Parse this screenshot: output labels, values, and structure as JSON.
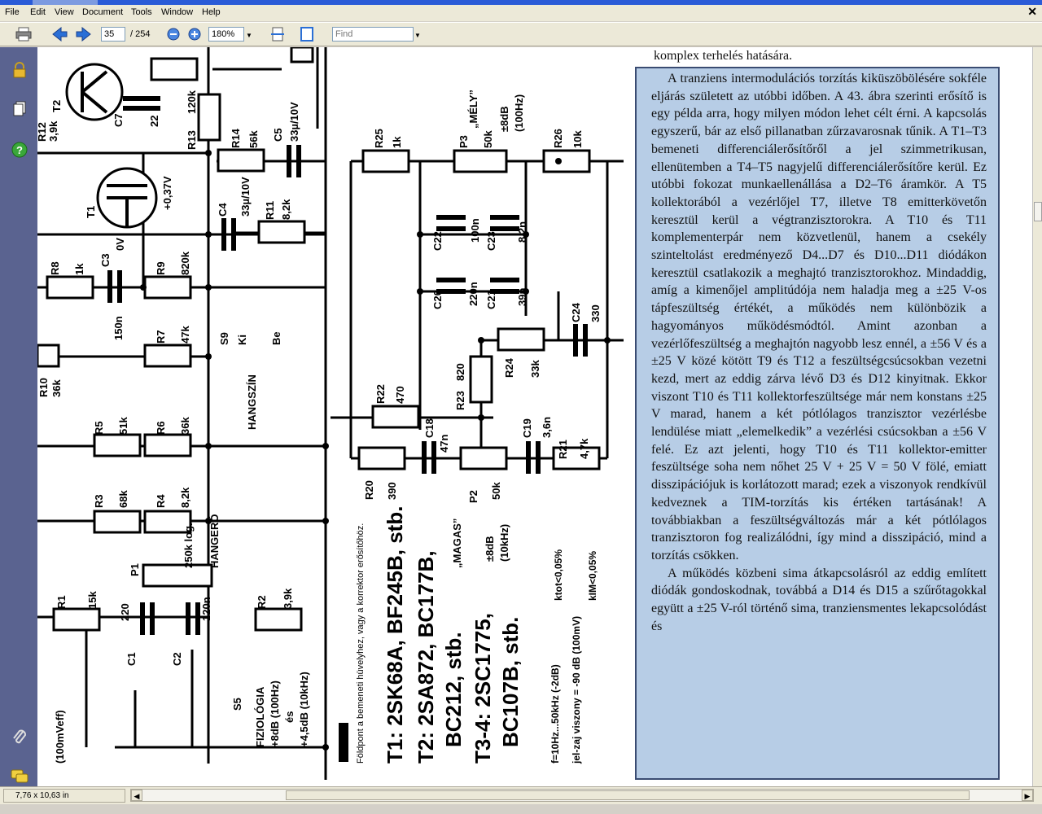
{
  "menu": [
    "File",
    "Edit",
    "View",
    "Document",
    "Tools",
    "Window",
    "Help"
  ],
  "toolbar": {
    "page_current": "35",
    "page_total": "/ 254",
    "zoom": "180%",
    "find_placeholder": "Find"
  },
  "status": {
    "page_size": "7,76 x 10,63 in"
  },
  "icons": [
    "print-icon",
    "prev-page-icon",
    "next-page-icon",
    "zoom-out-icon",
    "zoom-in-icon",
    "fit-width-icon",
    "fit-page-icon",
    "lock-icon",
    "pages-icon",
    "help-icon",
    "attachment-icon",
    "comments-icon"
  ],
  "colors": {
    "highlight_fill": "#b7cde6",
    "highlight_border": "#3a4c72",
    "sidebar": "#5a6390"
  },
  "document": {
    "top_line": "komplex terhelés hatására.",
    "paragraph1": "A tranziens intermodulációs torzítás kiküszöbölésére sokféle eljárás született az utóbbi időben. A 43. ábra szerinti erősítő is egy példa arra, hogy milyen módon lehet célt érni. A kapcsolás egyszerű, bár az első pillanatban zűrzavarosnak tűnik. A T1–T3 bemeneti differenciálerősítőről a jel szimmetrikusan, ellenütemben a T4–T5 nagyjelű differenciálerősítőre kerül. Ez utóbbi fokozat munkaellenállása a D2–T6 áramkör. A T5 kollektorából a vezérlőjel T7, illetve T8 emitterkövetőn keresztül kerül a végtranzisztorokra. A T10 és T11 komplementerpár nem közvetlenül, hanem a csekély szinteltolást eredményező D4...D7 és D10...D11 diódákon keresztül csatlakozik a meghajtó tranzisztorokhoz. Mindaddig, amíg a kimenőjel amplitúdója nem haladja meg a ±25 V-os tápfeszültség értékét, a működés nem különbözik a hagyományos működésmódtól. Amint azonban a vezérlőfeszültség a meghajtón nagyobb lesz ennél, a ±56 V és a ±25 V közé kötött T9 és T12 a feszültségcsúcsokban vezetni kezd, mert az eddig zárva lévő D3 és D12 kinyitnak. Ekkor viszont T10 és T11 kollektorfeszültsége már nem konstans ±25 V marad, hanem a két pótlólagos tranzisztor vezérlésbe lendülése miatt „elemelkedik” a vezérlési csúcsokban a ±56 V felé. Ez azt jelenti, hogy T10 és T11 kollektor-emitter feszültsége soha nem nőhet 25 V + 25 V = 50 V fölé, emiatt disszipációjuk is korlátozott marad; ezek a viszonyok rendkívül kedveznek a TIM-torzítás kis értéken tartásának! A továbbiakban a feszültségváltozás már a két pótlólagos tranzisztoron fog realizálódni, így mind a disszipáció, mind a torzítás csökken.",
    "paragraph2": "A működés közbeni sima átkapcsolásról az eddig említett diódák gondoskodnak, továbbá a D14 és D15 a szűrőtagokkal együtt a ±25 V-ról történő sima, tranziensmentes lekapcsolódást és"
  },
  "schematic_labels": [
    "T2",
    "T1",
    "C7",
    "22",
    "R12",
    "3,9k",
    "R13",
    "120k",
    "R14",
    "56k",
    "C5",
    "33µ/10V",
    "+0,37V",
    "0V",
    "C4",
    "33µ/10V",
    "R11",
    "8,2k",
    "R8",
    "1k",
    "C3",
    "150n",
    "R9",
    "820k",
    "R7",
    "47k",
    "R10",
    "36k",
    "S9",
    "Ki",
    "Be",
    "HANGSZÍN",
    "R5",
    "51k",
    "R6",
    "36k",
    "R3",
    "68k",
    "R4",
    "8,2k",
    "P1",
    "250k log.",
    "HANGERŐ",
    "R1",
    "15k",
    "C1",
    "220",
    "C2",
    "120n",
    "R2",
    "3,9k",
    "S5",
    "FIZIOLÓGIA",
    "+8dB (100Hz)",
    "és",
    "+4,5dB (10kHz)",
    "(100mVeff)",
    "R25",
    "1k",
    "P3",
    "„MÉLY”",
    "50k",
    "±8dB",
    "(100Hz)",
    "R26",
    "10k",
    "C22",
    "100n",
    "C23",
    "8,2n",
    "C20",
    "220n",
    "C21",
    "39n",
    "C24",
    "330",
    "R24",
    "33k",
    "R23",
    "820",
    "R22",
    "470",
    "C18",
    "47n",
    "P2",
    "„MAGAS”",
    "50k",
    "±8dB",
    "(10kHz)",
    "C19",
    "3,6n",
    "R21",
    "4,7k",
    "R20",
    "390",
    "Földpont a bemeneti hüvelyhez, vagy a korrektor erősítőhöz.",
    "T1: 2SK68A, BF245B, stb.",
    "T2: 2SA872, BC177B,",
    "BC212, stb.",
    "T3-4: 2SC1775,",
    "BC107B, stb.",
    "f=10Hz...50kHz (-2dB)",
    "jel-zaj viszony = -90 dB (100mV)",
    "ktot<0,05%",
    "kIM<0,05%"
  ]
}
